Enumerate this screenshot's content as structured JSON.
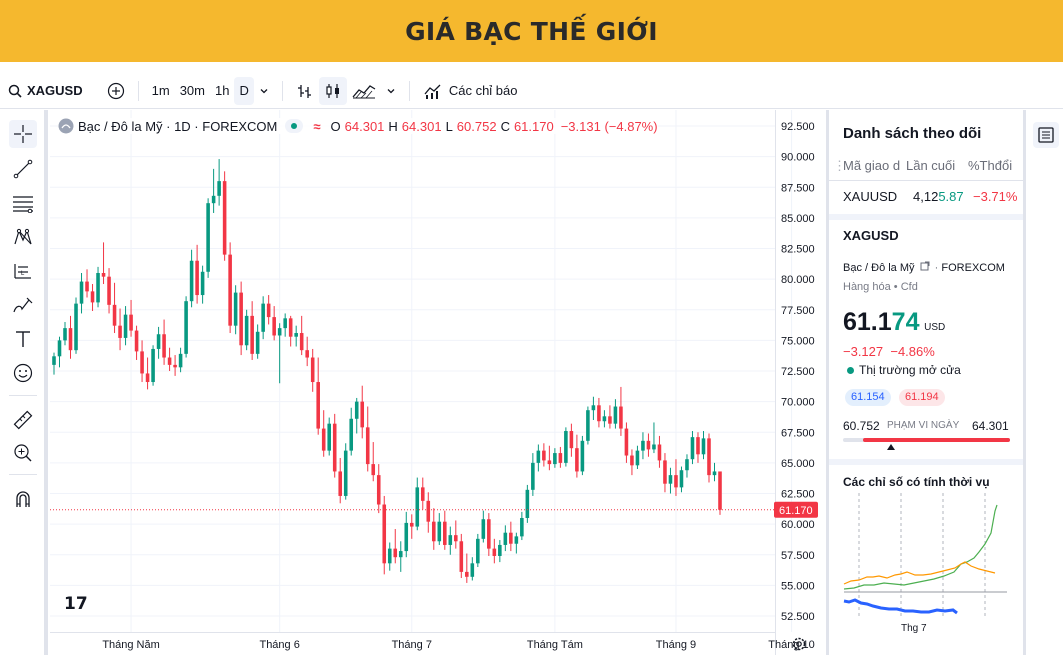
{
  "banner": {
    "title": "GIÁ BẠC THẾ GIỚI"
  },
  "toolbar": {
    "symbol": "XAGUSD",
    "intervals": [
      "1m",
      "30m",
      "1h",
      "D"
    ],
    "indicators_label": "Các chỉ báo"
  },
  "legend": {
    "name": "Bạc / Đô la Mỹ · 1D · FOREXCOM",
    "o_label": "O",
    "o_value": "64.301",
    "h_label": "H",
    "h_value": "64.301",
    "l_label": "L",
    "l_value": "60.752",
    "c_label": "C",
    "c_value": "61.170",
    "change": "−3.131 (−4.87%)"
  },
  "colors": {
    "up": "#089981",
    "down": "#f23645",
    "accent": "#f5b82e",
    "text": "#131722",
    "muted": "#6a6d78"
  },
  "chart_data": {
    "type": "candlestick",
    "y_ticks": [
      "92.500",
      "90.000",
      "87.500",
      "85.000",
      "82.500",
      "80.000",
      "77.500",
      "75.000",
      "72.500",
      "70.000",
      "67.500",
      "65.000",
      "62.500",
      "60.000",
      "57.500",
      "55.000",
      "52.500"
    ],
    "ylim": [
      52.5,
      92.5
    ],
    "x_ticks": [
      "Tháng Năm",
      "Tháng 6",
      "Tháng 7",
      "Tháng Tám",
      "Tháng 9",
      "Tháng 10"
    ],
    "last_price_label": "61.170",
    "last_price": 61.17,
    "candles": [
      [
        73.0,
        74.0,
        72.2,
        73.7
      ],
      [
        73.7,
        75.3,
        72.8,
        75.0
      ],
      [
        75.0,
        76.5,
        74.6,
        76.0
      ],
      [
        76.0,
        77.0,
        73.5,
        74.2
      ],
      [
        74.2,
        78.5,
        73.9,
        78.0
      ],
      [
        78.0,
        80.5,
        77.2,
        79.8
      ],
      [
        79.8,
        80.8,
        78.5,
        79.0
      ],
      [
        79.0,
        79.6,
        77.4,
        78.1
      ],
      [
        78.1,
        81.0,
        77.7,
        80.5
      ],
      [
        80.5,
        83.0,
        79.6,
        80.2
      ],
      [
        80.2,
        80.9,
        77.2,
        77.9
      ],
      [
        77.9,
        79.7,
        75.6,
        76.2
      ],
      [
        76.2,
        77.6,
        74.2,
        75.2
      ],
      [
        75.2,
        77.8,
        74.6,
        77.1
      ],
      [
        77.1,
        78.3,
        75.3,
        75.8
      ],
      [
        75.8,
        76.2,
        73.4,
        74.1
      ],
      [
        74.1,
        75.0,
        71.6,
        72.3
      ],
      [
        72.3,
        73.6,
        71.0,
        71.6
      ],
      [
        71.6,
        74.6,
        71.3,
        74.3
      ],
      [
        74.3,
        76.1,
        73.5,
        75.5
      ],
      [
        75.5,
        76.7,
        73.0,
        73.6
      ],
      [
        73.6,
        74.4,
        72.5,
        73.0
      ],
      [
        73.0,
        73.8,
        72.1,
        72.8
      ],
      [
        72.8,
        74.4,
        72.4,
        73.9
      ],
      [
        73.9,
        78.6,
        73.6,
        78.2
      ],
      [
        78.2,
        82.4,
        77.7,
        81.5
      ],
      [
        81.5,
        82.8,
        78.0,
        78.7
      ],
      [
        78.7,
        81.1,
        78.0,
        80.6
      ],
      [
        80.6,
        86.6,
        80.1,
        86.2
      ],
      [
        86.2,
        89.0,
        85.4,
        86.8
      ],
      [
        86.8,
        89.8,
        86.0,
        88.0
      ],
      [
        88.0,
        88.8,
        81.5,
        82.0
      ],
      [
        82.0,
        83.0,
        75.6,
        76.2
      ],
      [
        76.2,
        79.5,
        75.5,
        78.9
      ],
      [
        78.9,
        79.8,
        73.8,
        74.6
      ],
      [
        74.6,
        77.5,
        74.2,
        77.0
      ],
      [
        77.0,
        78.2,
        73.4,
        73.9
      ],
      [
        73.9,
        76.3,
        73.5,
        75.7
      ],
      [
        75.7,
        78.6,
        75.1,
        78.0
      ],
      [
        78.0,
        78.7,
        76.3,
        76.9
      ],
      [
        76.9,
        77.8,
        75.0,
        75.4
      ],
      [
        75.4,
        76.4,
        71.5,
        76.0
      ],
      [
        76.0,
        77.2,
        75.3,
        76.8
      ],
      [
        76.8,
        77.0,
        74.5,
        75.3
      ],
      [
        75.3,
        76.2,
        74.5,
        75.6
      ],
      [
        75.6,
        77.0,
        73.8,
        74.2
      ],
      [
        74.2,
        75.3,
        72.9,
        73.6
      ],
      [
        73.6,
        74.3,
        70.8,
        71.6
      ],
      [
        71.6,
        73.6,
        67.3,
        67.8
      ],
      [
        67.8,
        69.3,
        65.5,
        66.0
      ],
      [
        66.0,
        68.7,
        65.6,
        68.2
      ],
      [
        68.2,
        69.0,
        63.8,
        64.3
      ],
      [
        64.3,
        65.4,
        61.7,
        62.3
      ],
      [
        62.3,
        66.6,
        62.0,
        66.0
      ],
      [
        66.0,
        69.5,
        65.6,
        68.6
      ],
      [
        68.6,
        70.3,
        67.4,
        70.0
      ],
      [
        70.0,
        71.3,
        67.0,
        67.9
      ],
      [
        67.9,
        69.6,
        64.3,
        64.9
      ],
      [
        64.9,
        66.7,
        63.5,
        64.0
      ],
      [
        64.0,
        64.9,
        60.9,
        61.6
      ],
      [
        61.6,
        62.3,
        55.9,
        56.8
      ],
      [
        56.8,
        58.5,
        56.2,
        58.0
      ],
      [
        58.0,
        59.6,
        56.8,
        57.3
      ],
      [
        57.3,
        58.6,
        56.1,
        57.8
      ],
      [
        57.8,
        61.0,
        57.3,
        60.1
      ],
      [
        60.1,
        60.8,
        58.8,
        59.8
      ],
      [
        59.8,
        63.8,
        59.5,
        63.0
      ],
      [
        63.0,
        63.8,
        61.2,
        61.9
      ],
      [
        61.9,
        62.6,
        59.3,
        60.2
      ],
      [
        60.2,
        61.3,
        57.9,
        58.6
      ],
      [
        58.6,
        60.9,
        58.3,
        60.2
      ],
      [
        60.2,
        61.1,
        57.9,
        58.3
      ],
      [
        58.3,
        59.8,
        57.5,
        59.1
      ],
      [
        59.1,
        60.3,
        58.0,
        58.6
      ],
      [
        58.6,
        59.2,
        55.6,
        56.1
      ],
      [
        56.1,
        57.6,
        55.2,
        55.7
      ],
      [
        55.7,
        57.3,
        55.4,
        56.8
      ],
      [
        56.8,
        59.2,
        56.5,
        58.8
      ],
      [
        58.8,
        61.1,
        58.5,
        60.4
      ],
      [
        60.4,
        60.9,
        57.4,
        58.0
      ],
      [
        58.0,
        58.8,
        56.8,
        57.4
      ],
      [
        57.4,
        58.7,
        56.9,
        58.3
      ],
      [
        58.3,
        59.9,
        57.8,
        59.3
      ],
      [
        59.3,
        60.2,
        57.8,
        58.4
      ],
      [
        58.4,
        59.3,
        57.6,
        59.0
      ],
      [
        59.0,
        61.0,
        58.7,
        60.5
      ],
      [
        60.5,
        63.2,
        60.1,
        62.8
      ],
      [
        62.8,
        65.8,
        62.3,
        65.0
      ],
      [
        65.0,
        66.5,
        64.3,
        66.0
      ],
      [
        66.0,
        66.6,
        64.7,
        65.2
      ],
      [
        65.2,
        66.4,
        64.4,
        64.9
      ],
      [
        64.9,
        66.2,
        64.6,
        65.8
      ],
      [
        65.8,
        66.3,
        64.6,
        65.0
      ],
      [
        65.0,
        67.9,
        64.7,
        67.6
      ],
      [
        67.6,
        68.2,
        65.5,
        66.2
      ],
      [
        66.2,
        67.3,
        63.8,
        64.3
      ],
      [
        64.3,
        67.2,
        64.0,
        66.8
      ],
      [
        66.8,
        69.6,
        66.5,
        69.3
      ],
      [
        69.3,
        70.4,
        68.5,
        69.7
      ],
      [
        69.7,
        70.3,
        67.9,
        68.4
      ],
      [
        68.4,
        69.3,
        67.9,
        68.8
      ],
      [
        68.8,
        69.7,
        67.8,
        68.2
      ],
      [
        68.2,
        70.2,
        67.8,
        69.6
      ],
      [
        69.6,
        71.2,
        67.2,
        67.8
      ],
      [
        67.8,
        68.3,
        65.0,
        65.6
      ],
      [
        65.6,
        66.1,
        64.0,
        64.8
      ],
      [
        64.8,
        66.4,
        64.5,
        66.0
      ],
      [
        66.0,
        67.5,
        65.3,
        66.8
      ],
      [
        66.8,
        67.4,
        65.5,
        66.1
      ],
      [
        66.1,
        68.3,
        65.8,
        66.5
      ],
      [
        66.5,
        67.2,
        64.6,
        65.2
      ],
      [
        65.2,
        65.8,
        62.6,
        63.3
      ],
      [
        63.3,
        64.6,
        62.5,
        64.0
      ],
      [
        64.0,
        65.3,
        62.3,
        63.0
      ],
      [
        63.0,
        64.7,
        62.6,
        64.4
      ],
      [
        64.4,
        65.7,
        63.8,
        65.3
      ],
      [
        65.3,
        67.6,
        64.9,
        67.1
      ],
      [
        67.1,
        67.5,
        65.0,
        65.7
      ],
      [
        65.7,
        67.6,
        65.3,
        67.0
      ],
      [
        67.0,
        67.4,
        63.4,
        64.0
      ],
      [
        64.0,
        65.0,
        63.5,
        64.3
      ],
      [
        64.3,
        64.3,
        60.752,
        61.17
      ]
    ]
  },
  "watchlist": {
    "title": "Danh sách theo dõi",
    "col_symbol": "Mã giao d",
    "col_last": "Lần cuối",
    "col_change": "%Thđổi",
    "row_symbol": "XAUUSD",
    "row_last_a": "4,12",
    "row_last_b": "5.87",
    "row_change": "−3.71%"
  },
  "details": {
    "symbol": "XAGUSD",
    "name": "Bạc / Đô la Mỹ",
    "exchange": "FOREXCOM",
    "category": "Hàng hóa",
    "type": "Cfd",
    "price_main": "61.1",
    "price_tail": "74",
    "currency": "USD",
    "change": "−3.127",
    "change_pct": "−4.86%",
    "market_status": "Thị trường mở cửa",
    "bid": "61.154",
    "ask": "61.194",
    "range_low": "60.752",
    "range_label": "PHẠM VI NGÀY",
    "range_high": "64.301",
    "seasonal_title": "Các chỉ số có tính thời vụ",
    "seasonal_x_label": "Thg 7"
  }
}
